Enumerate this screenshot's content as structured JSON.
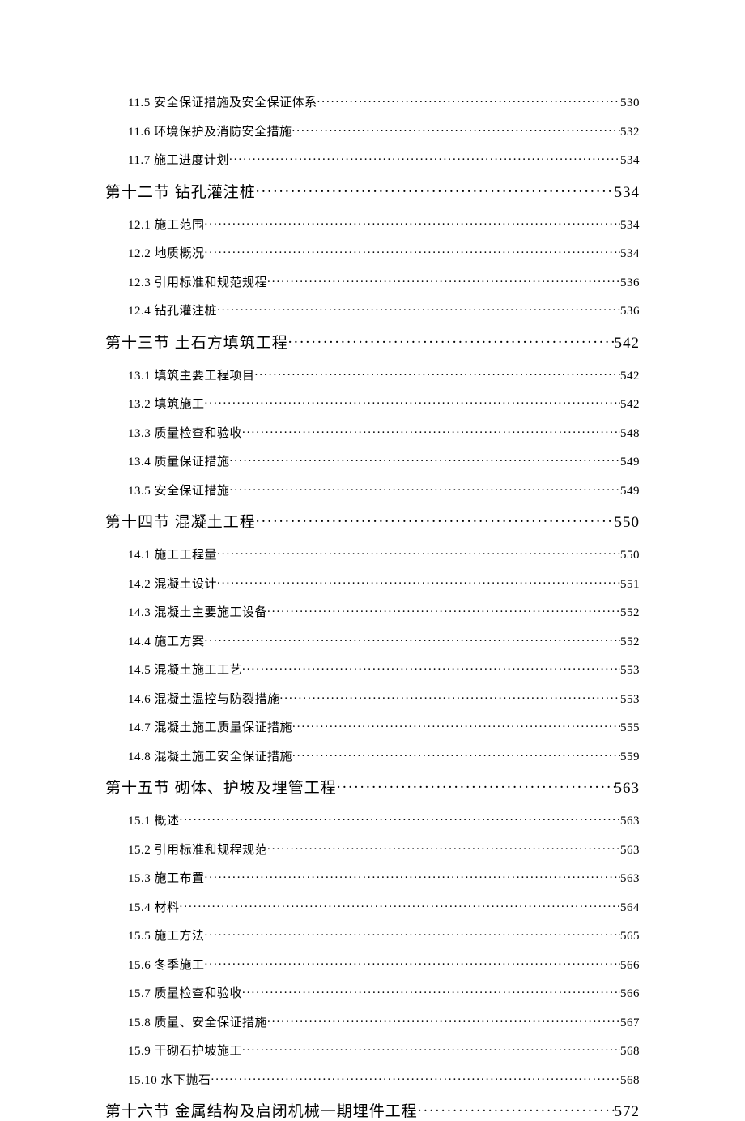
{
  "entries": [
    {
      "level": "sub",
      "label": "11.5 安全保证措施及安全保证体系",
      "page": "530"
    },
    {
      "level": "sub",
      "label": "11.6 环境保护及消防安全措施",
      "page": "532"
    },
    {
      "level": "sub",
      "label": "11.7 施工进度计划",
      "page": "534"
    },
    {
      "level": "section",
      "label": "第十二节 钻孔灌注桩",
      "page": "534"
    },
    {
      "level": "sub",
      "label": "12.1 施工范围",
      "page": "534"
    },
    {
      "level": "sub",
      "label": "12.2 地质概况",
      "page": "534"
    },
    {
      "level": "sub",
      "label": "12.3 引用标准和规范规程",
      "page": "536"
    },
    {
      "level": "sub",
      "label": "12.4 钻孔灌注桩",
      "page": "536"
    },
    {
      "level": "section",
      "label": "第十三节 土石方填筑工程",
      "page": "542"
    },
    {
      "level": "sub",
      "label": "13.1 填筑主要工程项目",
      "page": "542"
    },
    {
      "level": "sub",
      "label": "13.2 填筑施工",
      "page": "542"
    },
    {
      "level": "sub",
      "label": "13.3 质量检查和验收",
      "page": "548"
    },
    {
      "level": "sub",
      "label": "13.4 质量保证措施",
      "page": "549"
    },
    {
      "level": "sub",
      "label": "13.5 安全保证措施",
      "page": "549"
    },
    {
      "level": "section",
      "label": "第十四节 混凝土工程",
      "page": "550"
    },
    {
      "level": "sub",
      "label": "14.1 施工工程量",
      "page": "550"
    },
    {
      "level": "sub",
      "label": "14.2 混凝土设计",
      "page": "551"
    },
    {
      "level": "sub",
      "label": "14.3 混凝土主要施工设备",
      "page": "552"
    },
    {
      "level": "sub",
      "label": "14.4 施工方案",
      "page": "552"
    },
    {
      "level": "sub",
      "label": "14.5 混凝土施工工艺",
      "page": "553"
    },
    {
      "level": "sub",
      "label": "14.6 混凝土温控与防裂措施",
      "page": "553"
    },
    {
      "level": "sub",
      "label": "14.7 混凝土施工质量保证措施",
      "page": "555"
    },
    {
      "level": "sub",
      "label": "14.8 混凝土施工安全保证措施",
      "page": "559"
    },
    {
      "level": "section",
      "label": "第十五节 砌体、护坡及埋管工程",
      "page": "563"
    },
    {
      "level": "sub",
      "label": "15.1 概述",
      "page": "563"
    },
    {
      "level": "sub",
      "label": "15.2 引用标准和规程规范",
      "page": "563"
    },
    {
      "level": "sub",
      "label": "15.3 施工布置",
      "page": "563"
    },
    {
      "level": "sub",
      "label": "15.4 材料",
      "page": "564"
    },
    {
      "level": "sub",
      "label": "15.5 施工方法",
      "page": "565"
    },
    {
      "level": "sub",
      "label": "15.6 冬季施工",
      "page": "566"
    },
    {
      "level": "sub",
      "label": "15.7 质量检查和验收",
      "page": "566"
    },
    {
      "level": "sub",
      "label": "15.8 质量、安全保证措施",
      "page": "567"
    },
    {
      "level": "sub",
      "label": "15.9 干砌石护坡施工",
      "page": "568"
    },
    {
      "level": "sub",
      "label": "15.10 水下抛石",
      "page": "568"
    },
    {
      "level": "section",
      "label": "第十六节 金属结构及启闭机械一期埋件工程",
      "page": "572"
    }
  ]
}
